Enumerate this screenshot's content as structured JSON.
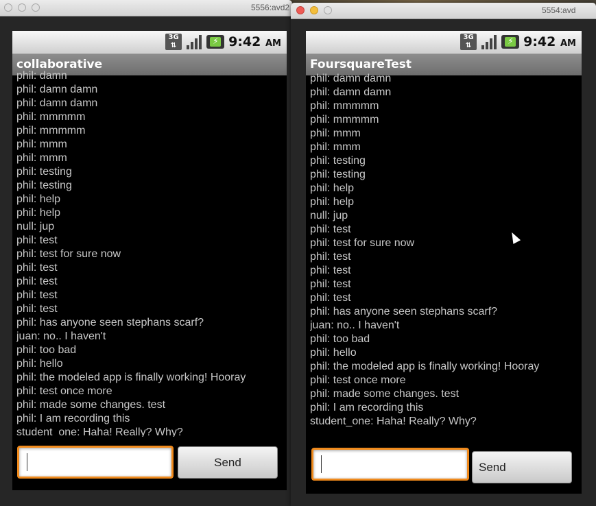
{
  "windows": [
    {
      "title": "5556:avd2",
      "status": {
        "clock": "9:42",
        "ampm": "AM",
        "network": "3G"
      },
      "app_title": "collaborative",
      "messages": [
        "phil: damn",
        "phil: damn damn",
        "phil: damn damn",
        "phil: mmmmm",
        "phil: mmmmm",
        "phil: mmm",
        "phil: mmm",
        "phil: testing",
        "phil: testing",
        "phil: help",
        "phil: help",
        "null: jup",
        "phil: test",
        "phil: test for sure now",
        "phil: test",
        "phil: test",
        "phil: test",
        "phil: test",
        "phil: has anyone seen stephans scarf?",
        "juan: no.. I haven't",
        "phil: too bad",
        "phil: hello",
        "phil: the modeled app is finally working! Hooray",
        "phil: test once more",
        "phil: made some changes. test",
        "phil: I am recording this",
        "student_one: Haha! Really? Why?"
      ],
      "input_value": "",
      "send_label": "Send"
    },
    {
      "title": "5554:avd",
      "status": {
        "clock": "9:42",
        "ampm": "AM",
        "network": "3G"
      },
      "app_title": "FoursquareTest",
      "messages": [
        "phil: damn damn",
        "phil: damn damn",
        "phil: mmmmm",
        "phil: mmmmm",
        "phil: mmm",
        "phil: mmm",
        "phil: testing",
        "phil: testing",
        "phil: help",
        "phil: help",
        "null: jup",
        "phil: test",
        "phil: test for sure now",
        "phil: test",
        "phil: test",
        "phil: test",
        "phil: test",
        "phil: has anyone seen stephans scarf?",
        "juan: no.. I haven't",
        "phil: too bad",
        "phil: hello",
        "phil: the modeled app is finally working! Hooray",
        "phil: test once more",
        "phil: made some changes. test",
        "phil: I am recording this",
        "student_one: Haha! Really? Why?"
      ],
      "input_value": "",
      "send_label": "Send"
    }
  ]
}
